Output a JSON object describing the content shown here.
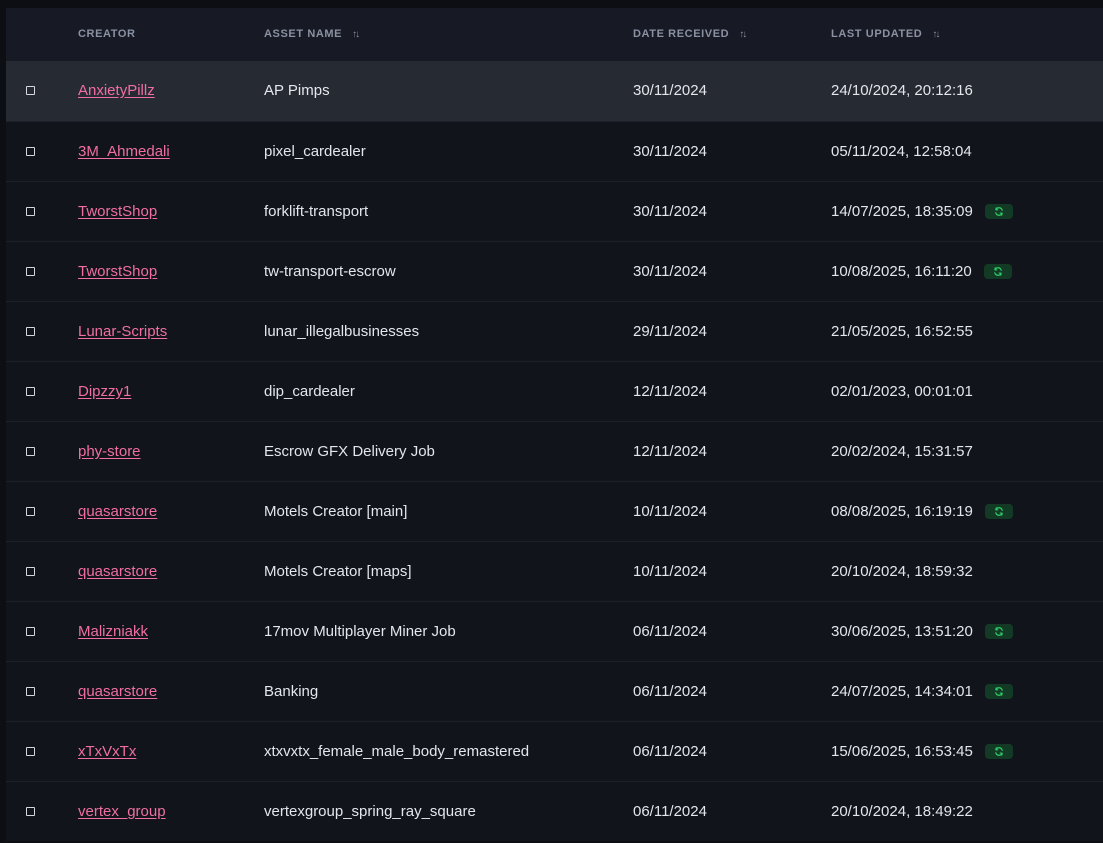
{
  "headers": {
    "creator": "Creator",
    "asset_name": "Asset Name",
    "date_received": "Date Received",
    "last_updated": "Last Updated"
  },
  "icons": {
    "sort": "sort-arrows-icon",
    "update": "refresh-icon",
    "checkbox": "checkbox-unchecked"
  },
  "colors": {
    "link": "#f06ea4",
    "badge_bg": "#123a24",
    "badge_icon": "#2fcb6a"
  },
  "rows": [
    {
      "creator": "AnxietyPillz",
      "asset": "AP Pimps",
      "received": "30/11/2024",
      "updated": "24/10/2024, 20:12:16",
      "has_update": false,
      "selected": true
    },
    {
      "creator": "3M_Ahmedali",
      "asset": "pixel_cardealer",
      "received": "30/11/2024",
      "updated": "05/11/2024, 12:58:04",
      "has_update": false,
      "selected": false
    },
    {
      "creator": "TworstShop",
      "asset": "forklift-transport",
      "received": "30/11/2024",
      "updated": "14/07/2025, 18:35:09",
      "has_update": true,
      "selected": false
    },
    {
      "creator": "TworstShop",
      "asset": "tw-transport-escrow",
      "received": "30/11/2024",
      "updated": "10/08/2025, 16:11:20",
      "has_update": true,
      "selected": false
    },
    {
      "creator": "Lunar-Scripts",
      "asset": "lunar_illegalbusinesses",
      "received": "29/11/2024",
      "updated": "21/05/2025, 16:52:55",
      "has_update": false,
      "selected": false
    },
    {
      "creator": "Dipzzy1",
      "asset": "dip_cardealer",
      "received": "12/11/2024",
      "updated": "02/01/2023, 00:01:01",
      "has_update": false,
      "selected": false
    },
    {
      "creator": "phy-store",
      "asset": "Escrow GFX Delivery Job",
      "received": "12/11/2024",
      "updated": "20/02/2024, 15:31:57",
      "has_update": false,
      "selected": false
    },
    {
      "creator": "quasarstore",
      "asset": "Motels Creator [main]",
      "received": "10/11/2024",
      "updated": "08/08/2025, 16:19:19",
      "has_update": true,
      "selected": false
    },
    {
      "creator": "quasarstore",
      "asset": "Motels Creator [maps]",
      "received": "10/11/2024",
      "updated": "20/10/2024, 18:59:32",
      "has_update": false,
      "selected": false
    },
    {
      "creator": "Malizniakk",
      "asset": "17mov Multiplayer Miner Job",
      "received": "06/11/2024",
      "updated": "30/06/2025, 13:51:20",
      "has_update": true,
      "selected": false
    },
    {
      "creator": "quasarstore",
      "asset": "Banking",
      "received": "06/11/2024",
      "updated": "24/07/2025, 14:34:01",
      "has_update": true,
      "selected": false
    },
    {
      "creator": "xTxVxTx",
      "asset": "xtxvxtx_female_male_body_remastered",
      "received": "06/11/2024",
      "updated": "15/06/2025, 16:53:45",
      "has_update": true,
      "selected": false
    },
    {
      "creator": "vertex_group",
      "asset": "vertexgroup_spring_ray_square",
      "received": "06/11/2024",
      "updated": "20/10/2024, 18:49:22",
      "has_update": false,
      "selected": false
    }
  ]
}
